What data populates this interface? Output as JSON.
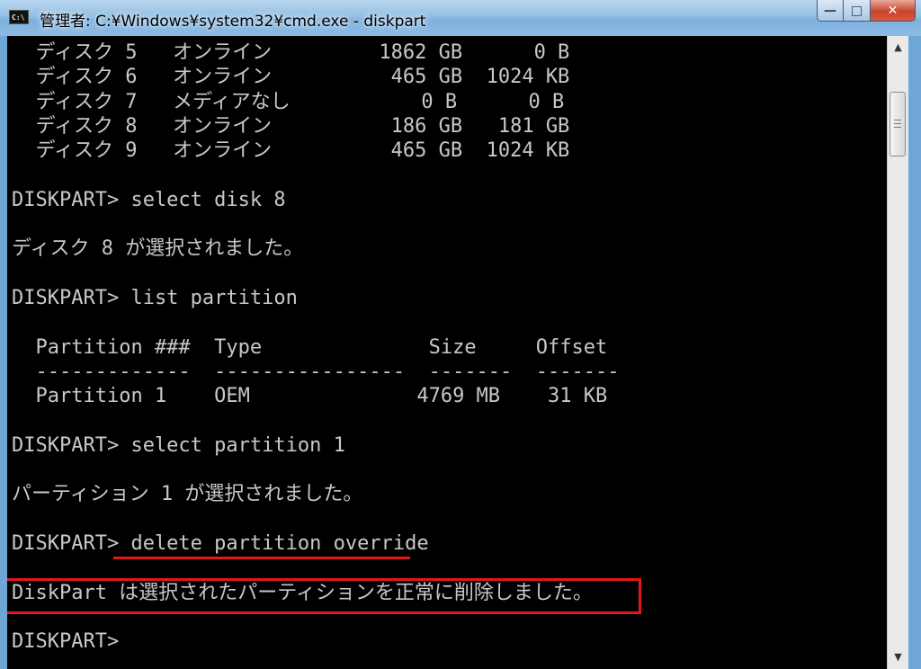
{
  "window": {
    "title": "管理者: C:¥Windows¥system32¥cmd.exe - diskpart",
    "icon": "cmd-icon",
    "icon_text": "C:\\",
    "buttons": {
      "minimize": "—",
      "maximize": "□",
      "close": "✕"
    }
  },
  "console": {
    "lines": [
      "  ディスク 5   オンライン         1862 GB      0 B",
      "  ディスク 6   オンライン          465 GB  1024 KB",
      "  ディスク 7   メディアなし           0 B      0 B",
      "  ディスク 8   オンライン          186 GB   181 GB",
      "  ディスク 9   オンライン          465 GB  1024 KB",
      "",
      "DISKPART> select disk 8",
      "",
      "ディスク 8 が選択されました。",
      "",
      "DISKPART> list partition",
      "",
      "  Partition ###  Type              Size     Offset",
      "  -------------  ----------------  -------  -------",
      "  Partition 1    OEM              4769 MB    31 KB",
      "",
      "DISKPART> select partition 1",
      "",
      "パーティション 1 が選択されました。",
      "",
      "DISKPART> delete partition override",
      "",
      "DiskPart は選択されたパーティションを正常に削除しました。",
      "",
      "DISKPART>"
    ],
    "text_color": "#c8c8c8",
    "background": "#000000",
    "annotation_color": "#e4161b"
  },
  "scrollbar": {
    "up_arrow": "▲",
    "down_arrow": "▼"
  }
}
